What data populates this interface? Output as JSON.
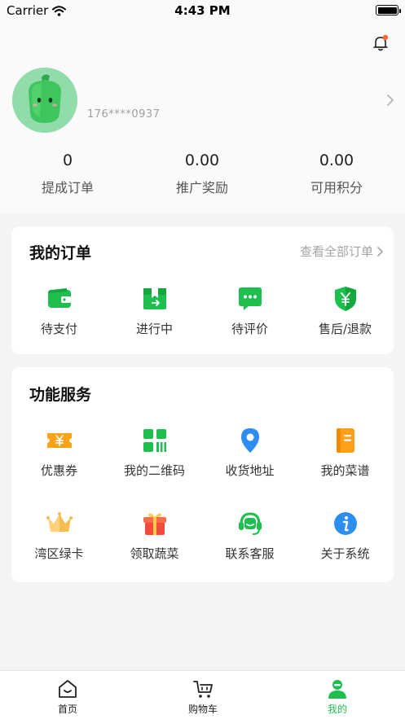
{
  "status_bar": {
    "carrier": "Carrier",
    "time": "4:43 PM"
  },
  "profile": {
    "phone": "176****0937"
  },
  "stats": [
    {
      "value": "0",
      "label": "提成订单"
    },
    {
      "value": "0.00",
      "label": "推广奖励"
    },
    {
      "value": "0.00",
      "label": "可用积分"
    }
  ],
  "orders": {
    "title": "我的订单",
    "view_all": "查看全部订单",
    "items": [
      {
        "label": "待支付",
        "icon": "wallet-icon"
      },
      {
        "label": "进行中",
        "icon": "package-icon"
      },
      {
        "label": "待评价",
        "icon": "chat-icon"
      },
      {
        "label": "售后/退款",
        "icon": "yen-shield-icon"
      }
    ]
  },
  "services": {
    "title": "功能服务",
    "items": [
      {
        "label": "优惠券",
        "icon": "coupon-icon"
      },
      {
        "label": "我的二维码",
        "icon": "qrcode-icon"
      },
      {
        "label": "收货地址",
        "icon": "location-pin-icon"
      },
      {
        "label": "我的菜谱",
        "icon": "recipe-book-icon"
      },
      {
        "label": "湾区绿卡",
        "icon": "crown-icon"
      },
      {
        "label": "领取蔬菜",
        "icon": "gift-icon"
      },
      {
        "label": "联系客服",
        "icon": "headset-icon"
      },
      {
        "label": "关于系统",
        "icon": "info-icon"
      }
    ]
  },
  "tabbar": [
    {
      "label": "首页",
      "icon": "home-icon"
    },
    {
      "label": "购物车",
      "icon": "cart-icon"
    },
    {
      "label": "我的",
      "icon": "user-icon",
      "active": true
    }
  ],
  "colors": {
    "accent": "#1fbf4f",
    "notification_dot": "#ff6a2b"
  }
}
